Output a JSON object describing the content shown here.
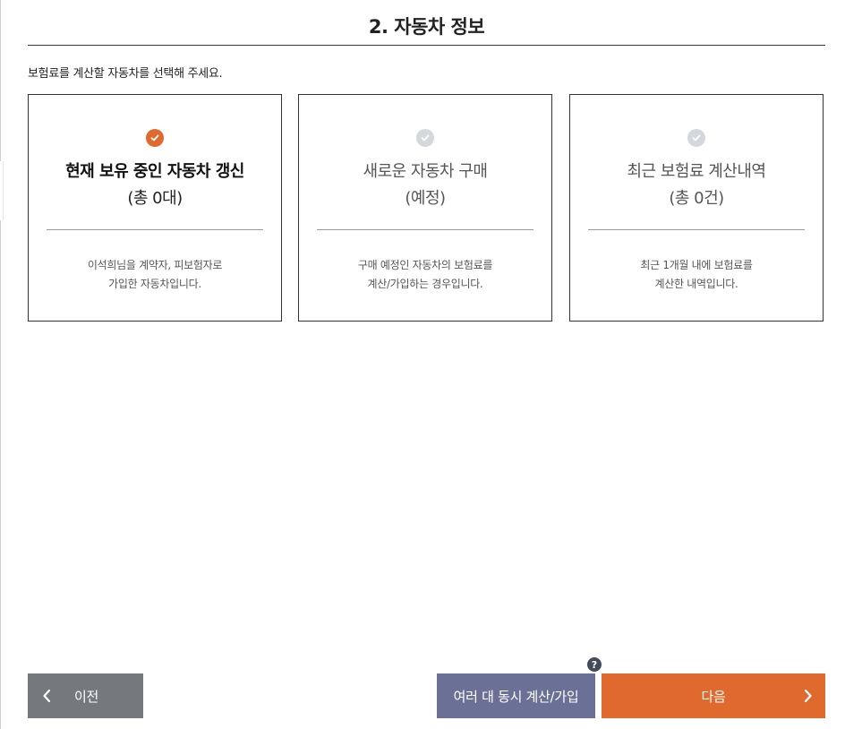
{
  "page": {
    "title": "2. 자동차 정보",
    "instruction": "보험료를 계산할 자동차를 선택해 주세요."
  },
  "cards": [
    {
      "heading": "현재 보유 중인 자동차 갱신",
      "count": "(총 0대)",
      "desc_line1": "이석희님을 계약자, 피보험자로",
      "desc_line2": "가입한 자동차입니다.",
      "selected": true
    },
    {
      "heading": "새로운 자동차 구매",
      "count": "(예정)",
      "desc_line1": "구매 예정인 자동차의 보험료를",
      "desc_line2": "계산/가입하는 경우입니다.",
      "selected": false
    },
    {
      "heading": "최근 보험료 계산내역",
      "count": "(총 0건)",
      "desc_line1": "최근 1개월 내에 보험료를",
      "desc_line2": "계산한 내역입니다.",
      "selected": false
    }
  ],
  "footer": {
    "prev_label": "이전",
    "multi_label": "여러 대 동시 계산/가입",
    "next_label": "다음",
    "help_symbol": "?"
  },
  "icons": {
    "check": "check-circle-icon",
    "prev": "chevron-left-icon",
    "next": "chevron-right-icon",
    "help": "question-circle-icon"
  },
  "colors": {
    "accent": "#e0692e",
    "multi_button": "#6b7196",
    "prev_button": "#75787d",
    "check_inactive": "#d4d8dc"
  }
}
